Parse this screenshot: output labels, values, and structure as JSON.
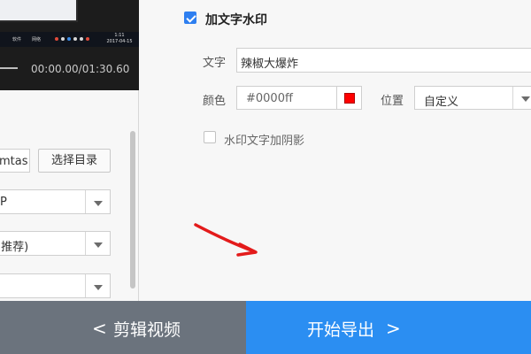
{
  "preview": {
    "taskbar_items": [
      "软件",
      "网络",
      "游戏",
      "辅助"
    ],
    "clock_time": "1:11",
    "clock_date": "2017-04-15",
    "timecode": "00:00.00/01:30.60"
  },
  "left_form": {
    "path_value": "mtas",
    "select_dir_button": "选择目录",
    "format_value": "P",
    "quality_value": "(推荐)",
    "third_value": ""
  },
  "watermark": {
    "enable_label": "加文字水印",
    "enabled": true,
    "text_label": "文字",
    "text_value": "辣椒大爆炸",
    "color_label": "颜色",
    "color_value": "#0000ff",
    "swatch_color": "#ff0000",
    "position_label": "位置",
    "position_value": "自定义",
    "shadow_label": "水印文字加阴影",
    "shadow_enabled": false
  },
  "footer": {
    "edit_button": "剪辑视频",
    "export_button": "开始导出",
    "left_chevron": "<",
    "right_chevron": ">"
  }
}
